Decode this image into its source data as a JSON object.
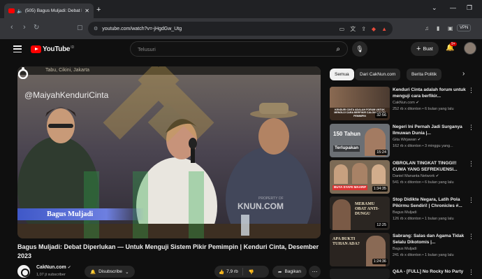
{
  "browser": {
    "tab_title": "(505) Bagus Muljadi: Debat D",
    "new_tab": "+",
    "url": "youtube.com/watch?v=-jHgdGw_Utg",
    "vpn_label": "VPN"
  },
  "youtube": {
    "logo_text": "YouTube",
    "logo_region": "ID",
    "search_placeholder": "Telusuri",
    "create_label": "Buat",
    "notification_count": "9+"
  },
  "video": {
    "location_text": "Tabu, Cikini, Jakarta",
    "watermark": "@MaiyahKenduriCinta",
    "caption": "Bagus Muljadi",
    "bg_watermark": "KNUN.COM",
    "property_text": "PROPERTY OF",
    "title": "Bagus Muljadi: Debat Diperlukan — Untuk Menguji Sistem Pikir Pemimpin | Kenduri Cinta, Desember 2023"
  },
  "channel": {
    "name": "CakNun.com",
    "verified": "✔",
    "subscribers": "1,07 jt subscriber",
    "subscribe_label": "Disubscribe",
    "likes": "7,9 rb",
    "share_label": "Bagikan"
  },
  "chips": [
    {
      "label": "Semua",
      "active": true
    },
    {
      "label": "Dari CakNun.com",
      "active": false
    },
    {
      "label": "Berita Politik",
      "active": false
    }
  ],
  "recommendations": [
    {
      "title": "Kenduri Cinta adalah forum untuk menguji cara berfikir...",
      "channel": "CakNun.com ✔",
      "meta": "252 rb x ditonton • 6 bulan yang lalu",
      "duration": "32:56",
      "thumb_text": "KENDURI CINTA ADALAH FORUM UNTUK MENGUJI CARA BERFIKIR CALON-CALON PEMIMPIN",
      "thumb_bg": "#3a2a1f"
    },
    {
      "title": "Negeri Ini Pernah Jadi Surganya Ilmuwan Dunia |...",
      "channel": "Gita Wirjawan ✔",
      "meta": "162 rb x ditonton • 3 minggu yang...",
      "duration": "15:24",
      "thumb_text": "150 Tahun",
      "thumb_text2": "Terlupakan",
      "thumb_bg": "#6b6f74"
    },
    {
      "title": "OBROLAN TINGKAT TINGGI!! CUMA YANG SEFREKUENSI...",
      "channel": "Daniel Mananta Network ✔",
      "meta": "541 rb x ditonton • 6 bulan yang lalu",
      "duration": "1:34:35",
      "thumb_text": "BUYA SYAFII MAARIF",
      "thumb_bg": "#7c6a55"
    },
    {
      "title": "Stop Didikte Negara, Latih Pola Pikirmu Sendiri! | Chronicles #...",
      "channel": "Bagus Muljadi",
      "meta": "126 rb x ditonton • 1 bulan yang lalu",
      "duration": "12:25",
      "thumb_text": "MERAMU OBAT ANTI-DUNGU",
      "thumb_bg": "#2b2622"
    },
    {
      "title": "Sabrang: Salas dan Agama Tidak Selalu Dikotomis |...",
      "channel": "Bagus Muljadi",
      "meta": "241 rb x ditonton • 1 bulan yang lalu",
      "duration": "1:24:36",
      "thumb_text": "APA BUKTI TUHAN ADA?",
      "thumb_bg": "#2a2420"
    },
    {
      "title": "Q&A - [FULL] No Rocky No Party",
      "channel": "",
      "meta": "",
      "duration": "",
      "thumb_text": "",
      "thumb_bg": "#1c1c1c"
    }
  ]
}
